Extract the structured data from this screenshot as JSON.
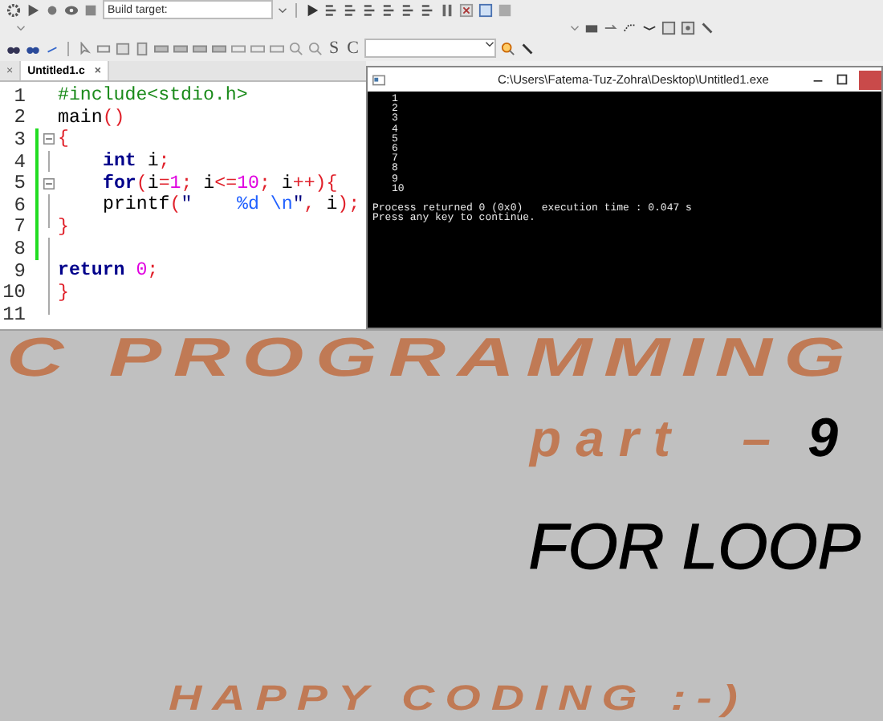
{
  "toolbar": {
    "build_target_label": "Build target:",
    "letter_buttons": [
      "S",
      "C"
    ]
  },
  "editor": {
    "tabs": [
      {
        "close": "×",
        "selected": false
      },
      {
        "label": "Untitled1.c",
        "close": "×",
        "selected": true
      }
    ],
    "lines": [
      {
        "number": "1",
        "kind": "plain",
        "changed": false,
        "indented": false,
        "tokens": [
          {
            "kind": "pre",
            "text": "#include<stdio.h>"
          }
        ]
      },
      {
        "number": "2",
        "kind": "plain",
        "changed": false,
        "indented": false,
        "tokens": [
          {
            "kind": "plain",
            "text": "main"
          },
          {
            "kind": "op",
            "text": "()"
          }
        ]
      },
      {
        "number": "3",
        "kind": "fold-start",
        "changed": true,
        "indented": false,
        "tokens": [
          {
            "kind": "op",
            "text": "{"
          }
        ]
      },
      {
        "number": "4",
        "kind": "fold-body",
        "changed": true,
        "indented": true,
        "tokens": [
          {
            "kind": "kw",
            "text": "int"
          },
          {
            "kind": "plain",
            "text": " i"
          },
          {
            "kind": "op",
            "text": ";"
          }
        ]
      },
      {
        "number": "5",
        "kind": "fold-start",
        "changed": true,
        "indented": true,
        "tokens": [
          {
            "kind": "kw",
            "text": "for"
          },
          {
            "kind": "op",
            "text": "("
          },
          {
            "kind": "plain",
            "text": "i"
          },
          {
            "kind": "op",
            "text": "="
          },
          {
            "kind": "num",
            "text": "1"
          },
          {
            "kind": "op",
            "text": ";"
          },
          {
            "kind": "plain",
            "text": " i"
          },
          {
            "kind": "op",
            "text": "<="
          },
          {
            "kind": "num",
            "text": "10"
          },
          {
            "kind": "op",
            "text": ";"
          },
          {
            "kind": "plain",
            "text": " i"
          },
          {
            "kind": "op",
            "text": "++){"
          }
        ]
      },
      {
        "number": "6",
        "kind": "fold-body",
        "changed": true,
        "indented": true,
        "tokens": [
          {
            "kind": "plain",
            "text": "printf"
          },
          {
            "kind": "op",
            "text": "("
          },
          {
            "kind": "str",
            "text": "\"    "
          },
          {
            "kind": "fmt",
            "text": "%d \\n"
          },
          {
            "kind": "str",
            "text": "\""
          },
          {
            "kind": "op",
            "text": ","
          },
          {
            "kind": "plain",
            "text": " i"
          },
          {
            "kind": "op",
            "text": ");"
          }
        ]
      },
      {
        "number": "7",
        "kind": "fold-end",
        "changed": true,
        "indented": false,
        "tokens": [
          {
            "kind": "op",
            "text": "}"
          }
        ]
      },
      {
        "number": "8",
        "kind": "fold-body",
        "changed": true
      },
      {
        "number": "9",
        "kind": "fold-body",
        "changed": false,
        "indented": false,
        "tokens": [
          {
            "kind": "kw",
            "text": "return"
          },
          {
            "kind": "num",
            "text": " 0"
          },
          {
            "kind": "op",
            "text": ";"
          }
        ]
      },
      {
        "number": "10",
        "kind": "fold-body",
        "changed": false,
        "indented": false,
        "tokens": [
          {
            "kind": "op",
            "text": "}"
          }
        ]
      },
      {
        "number": "11",
        "kind": "fold-end",
        "changed": false
      }
    ]
  },
  "console": {
    "title": "C:\\Users\\Fatema-Tuz-Zohra\\Desktop\\Untitled1.exe",
    "numbers": [
      "1",
      "2",
      "3",
      "4",
      "5",
      "6",
      "7",
      "8",
      "9",
      "10"
    ],
    "messages": [
      "Process returned 0 (0x0)   execution time : 0.047 s",
      "Press any key to continue."
    ]
  },
  "banner": {
    "title": "C PROGRAMMING",
    "part_label": "part  –",
    "part_number": "9",
    "topic": "FOR LOOP",
    "footer": "HAPPY CODING :-)"
  }
}
